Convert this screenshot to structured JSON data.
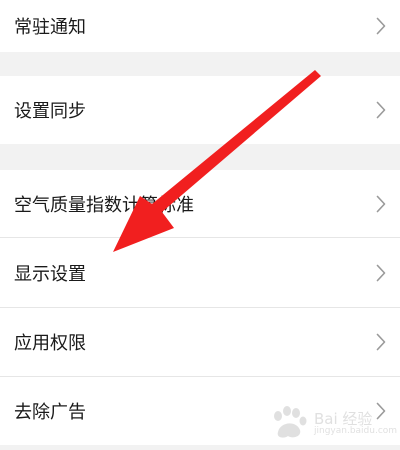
{
  "settings": {
    "items": [
      {
        "label": "常驻通知"
      },
      {
        "label": "设置同步"
      },
      {
        "label": "空气质量指数计算标准"
      },
      {
        "label": "显示设置"
      },
      {
        "label": "应用权限"
      },
      {
        "label": "去除广告"
      }
    ]
  },
  "watermark": {
    "text": "Bai 经验",
    "sub": "jingyan.baidu.com"
  },
  "colors": {
    "arrow": "#f11f1f",
    "row_background": "#ffffff",
    "group_gap": "#f2f2f2",
    "chevron": "#9a9a9a"
  },
  "icons": {
    "chevron": "chevron-right-icon",
    "annotation": "red-arrow-icon",
    "watermark": "baidu-paw-icon"
  }
}
